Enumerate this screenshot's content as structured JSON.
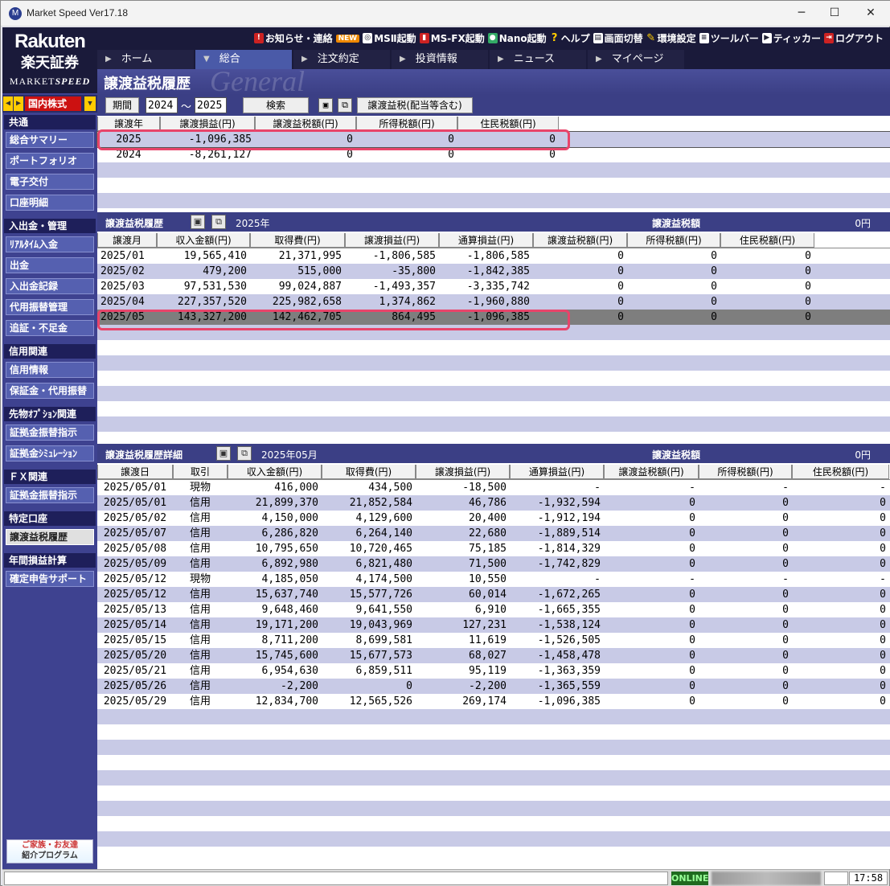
{
  "window": {
    "title": "Market Speed Ver17.18",
    "minimize": "─",
    "maximize": "☐",
    "close": "✕"
  },
  "logo": {
    "line1": "Rakuten",
    "line2": "楽天証券",
    "line3a": "MARKET",
    "line3b": "SPEED"
  },
  "toolmenu": [
    {
      "label": "お知らせ・連絡",
      "icon": "notice-icon"
    },
    {
      "label": "NEW",
      "badge": true
    },
    {
      "label": "MSⅡ起動",
      "icon": "ms2-launch-icon"
    },
    {
      "label": "MS-FX起動",
      "icon": "msfx-launch-icon"
    },
    {
      "label": "Nano起動",
      "icon": "nano-launch-icon"
    },
    {
      "label": "ヘルプ",
      "icon": "help-icon"
    },
    {
      "label": "画面切替",
      "icon": "screen-switch-icon"
    },
    {
      "label": "環境設定",
      "icon": "settings-icon"
    },
    {
      "label": "ツールバー",
      "icon": "toolbar-icon"
    },
    {
      "label": "ティッカー",
      "icon": "ticker-icon"
    },
    {
      "label": "ログアウト",
      "icon": "logout-icon"
    }
  ],
  "nav_tabs": [
    "ホーム",
    "総合",
    "注文約定",
    "投資情報",
    "ニュース",
    "マイページ"
  ],
  "active_tab": "総合",
  "banner": {
    "title": "譲渡益税履歴",
    "watermark": "General"
  },
  "market_selector": {
    "value": "国内株式"
  },
  "sidebar": {
    "sections": [
      {
        "title": "共通",
        "items": [
          "総合サマリー",
          "ポートフォリオ",
          "電子交付",
          "口座明細"
        ]
      },
      {
        "title": "入出金・管理",
        "items": [
          "ﾘｱﾙﾀｲﾑ入金",
          "出金",
          "入出金記録",
          "代用振替管理",
          "追証・不足金"
        ]
      },
      {
        "title": "信用関連",
        "items": [
          "信用情報",
          "保証金・代用振替"
        ]
      },
      {
        "title": "先物ｵﾌﾟｼｮﾝ関連",
        "items": [
          "証拠金振替指示",
          "証拠金ｼﾐｭﾚｰｼｮﾝ"
        ]
      },
      {
        "title": "ＦＸ関連",
        "items": [
          "証拠金振替指示"
        ]
      },
      {
        "title": "特定口座",
        "items": [
          "譲渡益税履歴"
        ]
      },
      {
        "title": "年間損益計算",
        "items": [
          "確定申告サポート"
        ]
      }
    ],
    "active_item": "譲渡益税履歴",
    "promo": {
      "line1": "ご家族・お友達",
      "line2": "紹介プログラム"
    }
  },
  "filter": {
    "period_label": "期間",
    "from": "2024",
    "sep": "～",
    "to": "2025",
    "search_label": "検索",
    "type_button": "譲渡益税(配当等含む)"
  },
  "yearly": {
    "headers": [
      "譲渡年",
      "譲渡損益(円)",
      "譲渡益税額(円)",
      "所得税額(円)",
      "住民税額(円)"
    ],
    "rows": [
      [
        "2025",
        "-1,096,385",
        "0",
        "0",
        "0"
      ],
      [
        "2024",
        "-8,261,127",
        "0",
        "0",
        "0"
      ]
    ]
  },
  "monthly": {
    "title": "譲渡益税履歴",
    "period": "2025年",
    "tax_label": "譲渡益税額",
    "tax_value": "0円",
    "headers": [
      "譲渡月",
      "収入金額(円)",
      "取得費(円)",
      "譲渡損益(円)",
      "通算損益(円)",
      "譲渡益税額(円)",
      "所得税額(円)",
      "住民税額(円)"
    ],
    "rows": [
      [
        "2025/01",
        "19,565,410",
        "21,371,995",
        "-1,806,585",
        "-1,806,585",
        "0",
        "0",
        "0"
      ],
      [
        "2025/02",
        "479,200",
        "515,000",
        "-35,800",
        "-1,842,385",
        "0",
        "0",
        "0"
      ],
      [
        "2025/03",
        "97,531,530",
        "99,024,887",
        "-1,493,357",
        "-3,335,742",
        "0",
        "0",
        "0"
      ],
      [
        "2025/04",
        "227,357,520",
        "225,982,658",
        "1,374,862",
        "-1,960,880",
        "0",
        "0",
        "0"
      ],
      [
        "2025/05",
        "143,327,200",
        "142,462,705",
        "864,495",
        "-1,096,385",
        "0",
        "0",
        "0"
      ]
    ]
  },
  "detail": {
    "title": "譲渡益税履歴詳細",
    "period": "2025年05月",
    "tax_label": "譲渡益税額",
    "tax_value": "0円",
    "headers": [
      "譲渡日",
      "取引",
      "収入金額(円)",
      "取得費(円)",
      "譲渡損益(円)",
      "通算損益(円)",
      "譲渡益税額(円)",
      "所得税額(円)",
      "住民税額(円)"
    ],
    "rows": [
      [
        "2025/05/01",
        "現物",
        "416,000",
        "434,500",
        "-18,500",
        "-",
        "-",
        "-",
        "-"
      ],
      [
        "2025/05/01",
        "信用",
        "21,899,370",
        "21,852,584",
        "46,786",
        "-1,932,594",
        "0",
        "0",
        "0"
      ],
      [
        "2025/05/02",
        "信用",
        "4,150,000",
        "4,129,600",
        "20,400",
        "-1,912,194",
        "0",
        "0",
        "0"
      ],
      [
        "2025/05/07",
        "信用",
        "6,286,820",
        "6,264,140",
        "22,680",
        "-1,889,514",
        "0",
        "0",
        "0"
      ],
      [
        "2025/05/08",
        "信用",
        "10,795,650",
        "10,720,465",
        "75,185",
        "-1,814,329",
        "0",
        "0",
        "0"
      ],
      [
        "2025/05/09",
        "信用",
        "6,892,980",
        "6,821,480",
        "71,500",
        "-1,742,829",
        "0",
        "0",
        "0"
      ],
      [
        "2025/05/12",
        "現物",
        "4,185,050",
        "4,174,500",
        "10,550",
        "-",
        "-",
        "-",
        "-"
      ],
      [
        "2025/05/12",
        "信用",
        "15,637,740",
        "15,577,726",
        "60,014",
        "-1,672,265",
        "0",
        "0",
        "0"
      ],
      [
        "2025/05/13",
        "信用",
        "9,648,460",
        "9,641,550",
        "6,910",
        "-1,665,355",
        "0",
        "0",
        "0"
      ],
      [
        "2025/05/14",
        "信用",
        "19,171,200",
        "19,043,969",
        "127,231",
        "-1,538,124",
        "0",
        "0",
        "0"
      ],
      [
        "2025/05/15",
        "信用",
        "8,711,200",
        "8,699,581",
        "11,619",
        "-1,526,505",
        "0",
        "0",
        "0"
      ],
      [
        "2025/05/20",
        "信用",
        "15,745,600",
        "15,677,573",
        "68,027",
        "-1,458,478",
        "0",
        "0",
        "0"
      ],
      [
        "2025/05/21",
        "信用",
        "6,954,630",
        "6,859,511",
        "95,119",
        "-1,363,359",
        "0",
        "0",
        "0"
      ],
      [
        "2025/05/26",
        "信用",
        "-2,200",
        "0",
        "-2,200",
        "-1,365,559",
        "0",
        "0",
        "0"
      ],
      [
        "2025/05/29",
        "信用",
        "12,834,700",
        "12,565,526",
        "269,174",
        "-1,096,385",
        "0",
        "0",
        "0"
      ]
    ]
  },
  "status": {
    "online": "ONLINE",
    "clock": "17:58"
  }
}
